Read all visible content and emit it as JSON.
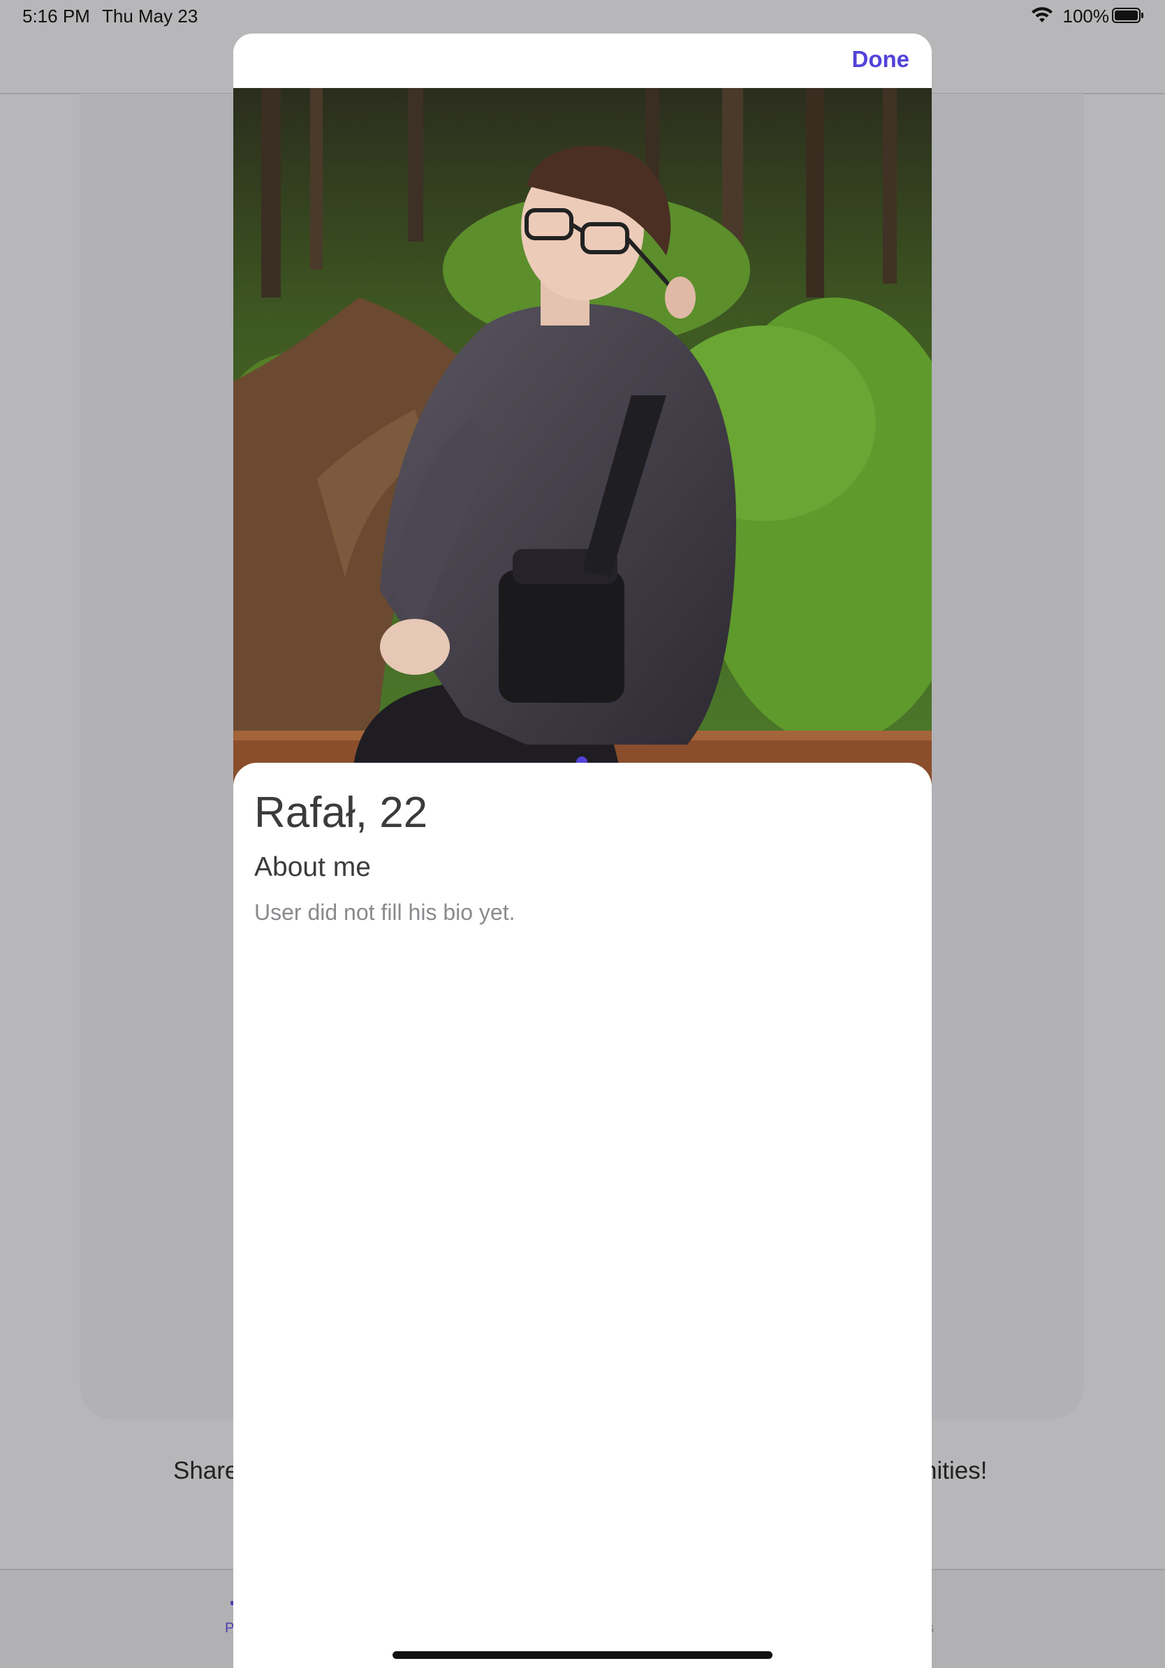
{
  "status_bar": {
    "time": "5:16 PM",
    "date": "Thu May 23",
    "battery_percent": "100%"
  },
  "background_app": {
    "share_text_left": "Share",
    "share_text_right": "nities!",
    "tab_left_label": "P",
    "tab_right_label": "gs"
  },
  "sheet": {
    "done_label": "Done"
  },
  "profile": {
    "name_age": "Rafał, 22",
    "about_title": "About me",
    "bio": "User did not fill his bio yet.",
    "photo_count": 1,
    "active_photo_index": 0
  },
  "colors": {
    "accent": "#5243d8",
    "dim_overlay": "#b7b7b9",
    "title_text": "#3b3b3d",
    "secondary_text": "#8a8a8e"
  },
  "icons": {
    "wifi": "wifi-icon",
    "battery": "battery-icon",
    "page_dot": "page-indicator-dot"
  }
}
